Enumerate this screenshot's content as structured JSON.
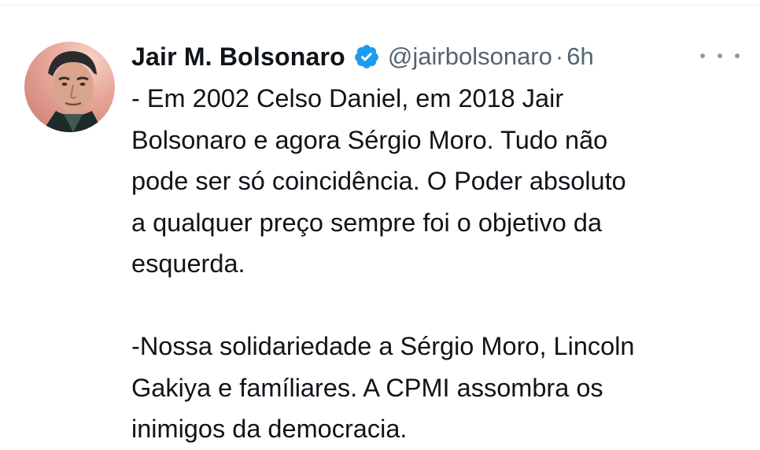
{
  "tweet": {
    "author": {
      "display_name": "Jair M. Bolsonaro",
      "handle": "@jairbolsonaro",
      "verified": true,
      "avatar": "profile-photo"
    },
    "separator": "·",
    "time": "6h",
    "more_icon": "more-horizontal-icon",
    "paragraph_1": [
      "- Em 2002 Celso Daniel, em 2018 Jair",
      "Bolsonaro e agora Sérgio Moro. Tudo não",
      "pode ser só coincidência. O Poder absoluto",
      "a qualquer preço sempre foi o objetivo da",
      "esquerda."
    ],
    "paragraph_2": [
      "-Nossa solidariedade a Sérgio Moro, Lincoln",
      "Gakiya e famíliares. A CPMI assombra os",
      "inimigos da democracia."
    ]
  },
  "colors": {
    "text_primary": "#0f1419",
    "text_secondary": "#536471",
    "verified_badge": "#1d9bf0"
  }
}
